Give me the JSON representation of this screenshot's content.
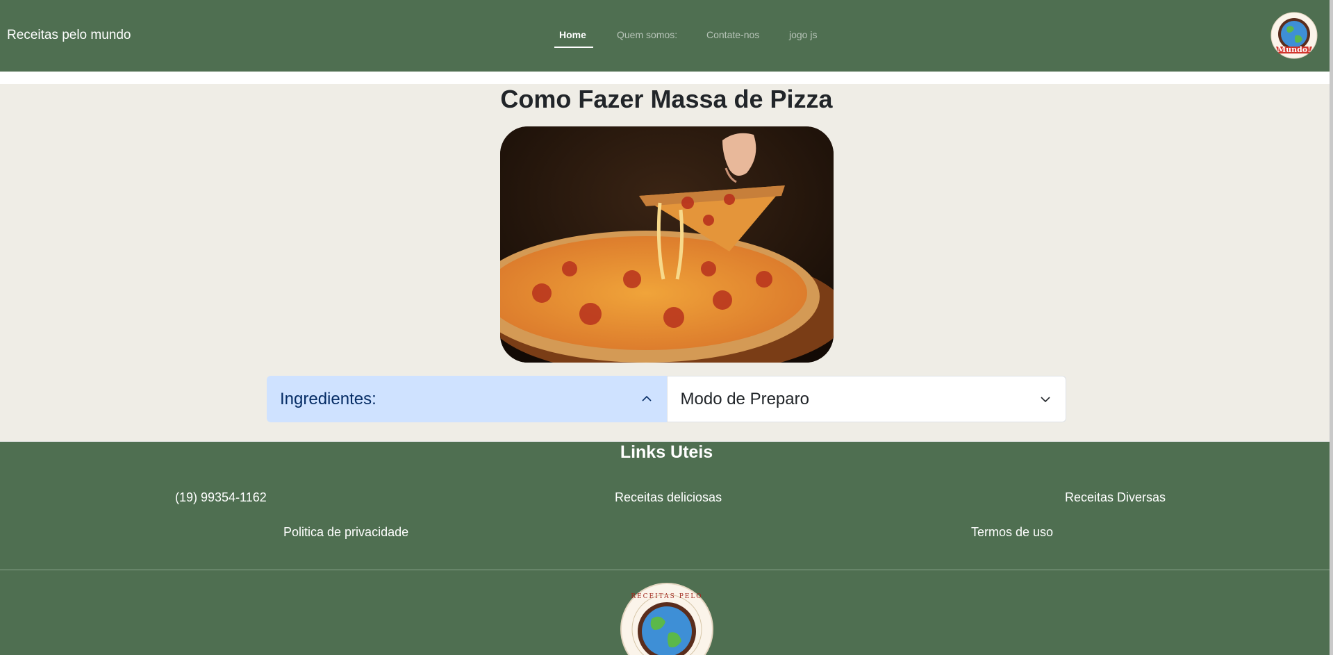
{
  "navbar": {
    "brand": "Receitas pelo mundo",
    "links": [
      {
        "label": "Home",
        "active": true
      },
      {
        "label": "Quem somos:",
        "active": false
      },
      {
        "label": "Contate-nos",
        "active": false
      },
      {
        "label": "jogo js",
        "active": false
      }
    ],
    "logo_text": "Mundo!"
  },
  "main": {
    "title": "Como Fazer Massa de Pizza",
    "image_subject": "pizza-slice-photo",
    "accordion": [
      {
        "label": "Ingredientes:",
        "expanded": true
      },
      {
        "label": "Modo de Preparo",
        "expanded": false
      }
    ]
  },
  "footer": {
    "title": "Links Uteis",
    "links_row1": [
      "(19) 99354-1162",
      "Receitas deliciosas",
      "Receitas Diversas"
    ],
    "links_row2": [
      "Politica de privacidade",
      "Termos de uso"
    ],
    "logo_text_top": "RECEITAS PELO"
  },
  "colors": {
    "nav_bg": "#4f6f51",
    "page_bg": "#efede6",
    "accordion_active_bg": "#cfe2ff",
    "accordion_active_text": "#052c65"
  }
}
